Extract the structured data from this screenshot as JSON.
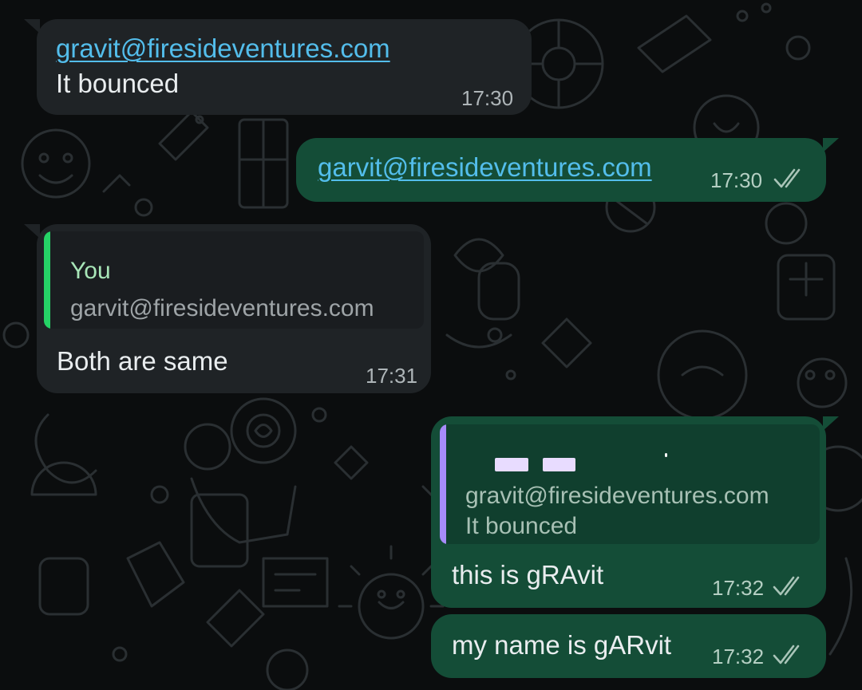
{
  "colors": {
    "incoming_bubble": "#1f2326",
    "outgoing_bubble": "#144d37",
    "link": "#53bdeb",
    "quote_bar_you": "#25d366",
    "quote_bar_other": "#a78bfa",
    "quote_author_you": "#a8e6b8"
  },
  "icons": {
    "read_receipt": "double-check-icon"
  },
  "messages": [
    {
      "direction": "incoming",
      "link": "gravit@firesideventures.com",
      "text": "It bounced",
      "time": "17:30"
    },
    {
      "direction": "outgoing",
      "link": "garvit@firesideventures.com",
      "time": "17:30",
      "status": "read"
    },
    {
      "direction": "incoming",
      "quote": {
        "author": "You",
        "text": "garvit@firesideventures.com"
      },
      "text": "Both are same",
      "time": "17:31"
    },
    {
      "direction": "outgoing",
      "quote": {
        "line1": "gravit@firesideventures.com",
        "line2": "It bounced"
      },
      "text": "this is gRAvit",
      "time": "17:32",
      "status": "read"
    },
    {
      "direction": "outgoing",
      "text": "my name is gARvit",
      "time": "17:32",
      "status": "read"
    }
  ]
}
